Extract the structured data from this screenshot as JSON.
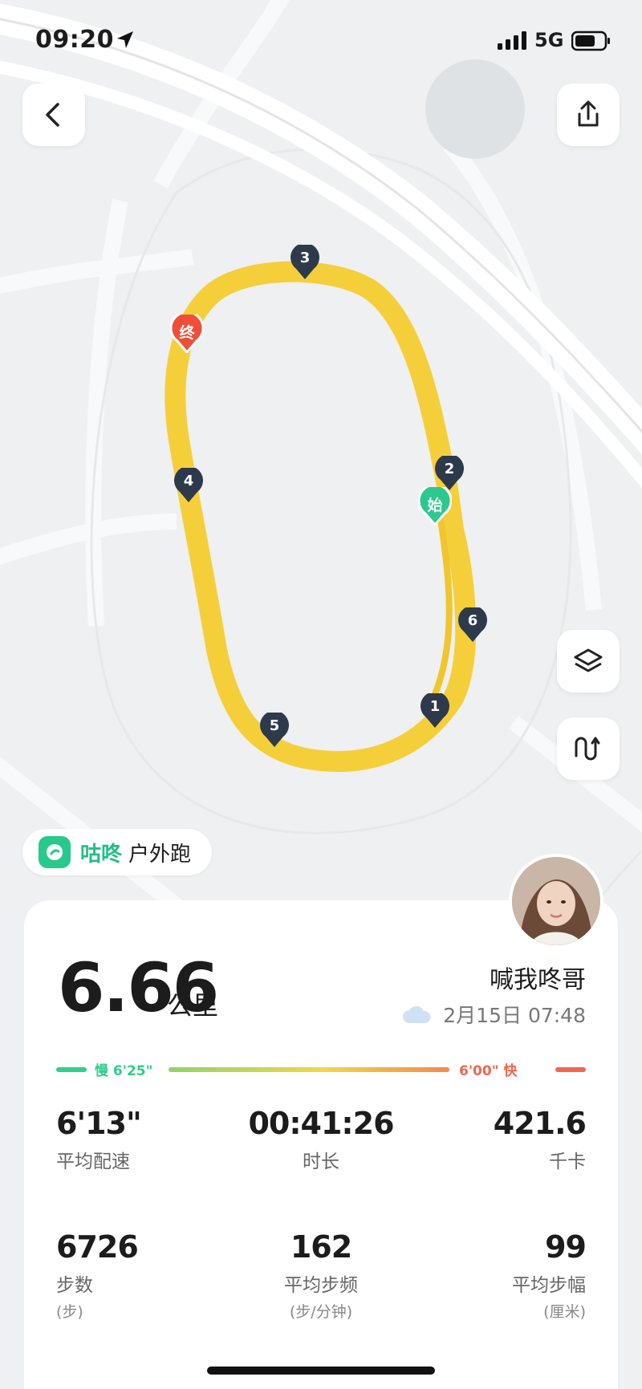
{
  "status_bar": {
    "time": "09:20",
    "network": "5G"
  },
  "map": {
    "start_marker": "始",
    "end_marker": "终",
    "km_markers": [
      "1",
      "2",
      "3",
      "4",
      "5",
      "6"
    ],
    "route_color": "#f5cf3a"
  },
  "buttons": {
    "back_icon": "chevron-left-icon",
    "share_icon": "share-icon",
    "layers_icon": "layers-icon",
    "route_icon": "route-icon"
  },
  "badge": {
    "brand": "咕咚",
    "activity": "户外跑"
  },
  "summary": {
    "distance": "6.66",
    "distance_unit": "公里",
    "user_name": "喊我咚哥",
    "date_time": "2月15日 07:48",
    "weather_icon": "cloud-icon"
  },
  "pace_bar": {
    "slow_label": "慢 6'25\"",
    "fast_label": "6'00\" 快",
    "slow_color": "#2fcf8c",
    "fast_color": "#f0674f"
  },
  "stats": [
    {
      "value": "6'13\"",
      "label": "平均配速",
      "unit": ""
    },
    {
      "value": "00:41:26",
      "label": "时长",
      "unit": ""
    },
    {
      "value": "421.6",
      "label": "千卡",
      "unit": ""
    },
    {
      "value": "6726",
      "label": "步数",
      "unit": "(步)"
    },
    {
      "value": "162",
      "label": "平均步频",
      "unit": "(步/分钟)"
    },
    {
      "value": "99",
      "label": "平均步幅",
      "unit": "(厘米)"
    }
  ]
}
